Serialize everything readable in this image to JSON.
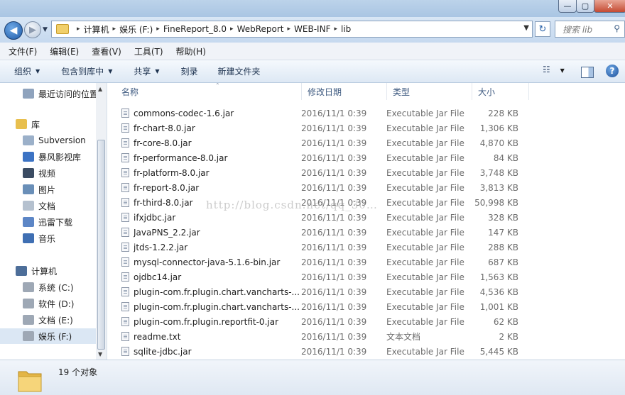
{
  "titlebar": {
    "min_label": "—",
    "max_label": "▢",
    "close_label": "✕"
  },
  "nav": {
    "back_glyph": "◀",
    "forward_glyph": "▶",
    "breadcrumbs": [
      "计算机",
      "娱乐 (F:)",
      "FineReport_8.0",
      "WebReport",
      "WEB-INF",
      "lib"
    ],
    "refresh_glyph": "↻",
    "search_placeholder": "搜索 lib"
  },
  "menu": [
    "文件(F)",
    "编辑(E)",
    "查看(V)",
    "工具(T)",
    "帮助(H)"
  ],
  "toolbar": {
    "organize": "组织",
    "include_in_library": "包含到库中",
    "share": "共享",
    "burn": "刻录",
    "new_folder": "新建文件夹"
  },
  "sidebar": [
    {
      "label": "最近访问的位置",
      "icon": "recent-places-icon",
      "color": "#8fa3bd"
    },
    {
      "label": "库",
      "icon": "library-icon",
      "color": "#e8bf4e"
    },
    {
      "label": "Subversion",
      "icon": "subversion-icon",
      "color": "#9bb0c9"
    },
    {
      "label": "暴风影视库",
      "icon": "storm-library-icon",
      "color": "#3c73c4"
    },
    {
      "label": "视频",
      "icon": "video-icon",
      "color": "#3b4c63"
    },
    {
      "label": "图片",
      "icon": "pictures-icon",
      "color": "#6a8fb8"
    },
    {
      "label": "文档",
      "icon": "documents-icon",
      "color": "#b5c1cf"
    },
    {
      "label": "迅雷下载",
      "icon": "thunder-download-icon",
      "color": "#5c86c6"
    },
    {
      "label": "音乐",
      "icon": "music-icon",
      "color": "#3f6fb3"
    },
    {
      "label": "计算机",
      "icon": "computer-icon",
      "color": "#4d6e99"
    },
    {
      "label": "系统 (C:)",
      "icon": "drive-c-icon",
      "color": "#9ea8b5"
    },
    {
      "label": "软件 (D:)",
      "icon": "drive-d-icon",
      "color": "#9ea8b5"
    },
    {
      "label": "文档 (E:)",
      "icon": "drive-e-icon",
      "color": "#9ea8b5"
    },
    {
      "label": "娱乐 (F:)",
      "icon": "drive-f-icon",
      "color": "#9ea8b5"
    }
  ],
  "columns": {
    "name": "名称",
    "date": "修改日期",
    "type": "类型",
    "size": "大小"
  },
  "files": [
    {
      "name": "commons-codec-1.6.jar",
      "date": "2016/11/1 0:39",
      "type": "Executable Jar File",
      "size": "228 KB"
    },
    {
      "name": "fr-chart-8.0.jar",
      "date": "2016/11/1 0:39",
      "type": "Executable Jar File",
      "size": "1,306 KB"
    },
    {
      "name": "fr-core-8.0.jar",
      "date": "2016/11/1 0:39",
      "type": "Executable Jar File",
      "size": "4,870 KB"
    },
    {
      "name": "fr-performance-8.0.jar",
      "date": "2016/11/1 0:39",
      "type": "Executable Jar File",
      "size": "84 KB"
    },
    {
      "name": "fr-platform-8.0.jar",
      "date": "2016/11/1 0:39",
      "type": "Executable Jar File",
      "size": "3,748 KB"
    },
    {
      "name": "fr-report-8.0.jar",
      "date": "2016/11/1 0:39",
      "type": "Executable Jar File",
      "size": "3,813 KB"
    },
    {
      "name": "fr-third-8.0.jar",
      "date": "2016/11/1 0:39",
      "type": "Executable Jar File",
      "size": "50,998 KB"
    },
    {
      "name": "ifxjdbc.jar",
      "date": "2016/11/1 0:39",
      "type": "Executable Jar File",
      "size": "328 KB"
    },
    {
      "name": "JavaPNS_2.2.jar",
      "date": "2016/11/1 0:39",
      "type": "Executable Jar File",
      "size": "147 KB"
    },
    {
      "name": "jtds-1.2.2.jar",
      "date": "2016/11/1 0:39",
      "type": "Executable Jar File",
      "size": "288 KB"
    },
    {
      "name": "mysql-connector-java-5.1.6-bin.jar",
      "date": "2016/11/1 0:39",
      "type": "Executable Jar File",
      "size": "687 KB"
    },
    {
      "name": "ojdbc14.jar",
      "date": "2016/11/1 0:39",
      "type": "Executable Jar File",
      "size": "1,563 KB"
    },
    {
      "name": "plugin-com.fr.plugin.chart.vancharts-...",
      "date": "2016/11/1 0:39",
      "type": "Executable Jar File",
      "size": "4,536 KB"
    },
    {
      "name": "plugin-com.fr.plugin.chart.vancharts-...",
      "date": "2016/11/1 0:39",
      "type": "Executable Jar File",
      "size": "1,001 KB"
    },
    {
      "name": "plugin-com.fr.plugin.reportfit-0.jar",
      "date": "2016/11/1 0:39",
      "type": "Executable Jar File",
      "size": "62 KB"
    },
    {
      "name": "readme.txt",
      "date": "2016/11/1 0:39",
      "type": "文本文档",
      "size": "2 KB"
    },
    {
      "name": "sqlite-jdbc.jar",
      "date": "2016/11/1 0:39",
      "type": "Executable Jar File",
      "size": "5,445 KB"
    }
  ],
  "watermark": "http://blog.csdn.net/qq_30…",
  "status": {
    "count": "19 个对象"
  }
}
